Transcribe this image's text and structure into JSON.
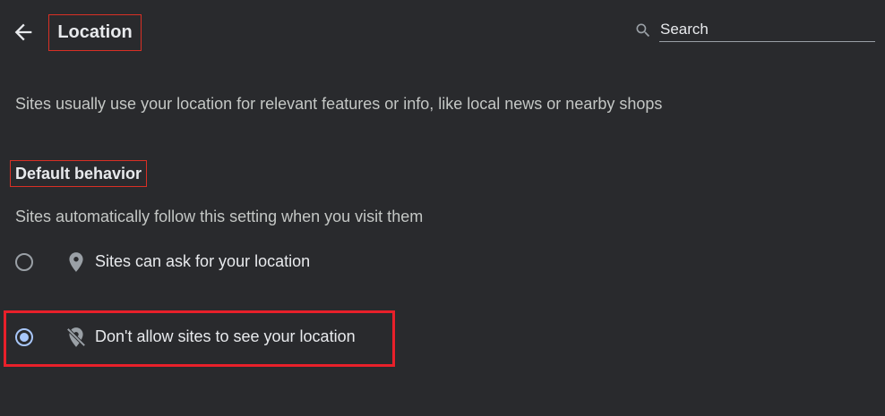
{
  "header": {
    "title": "Location",
    "back_icon": "arrow-left-icon",
    "search": {
      "placeholder": "Search",
      "icon": "search-icon"
    }
  },
  "description": "Sites usually use your location for relevant features or info, like local news or nearby shops",
  "default_behavior": {
    "heading": "Default behavior",
    "subtext": "Sites automatically follow this setting when you visit them",
    "options": [
      {
        "label": "Sites can ask for your location",
        "icon": "location-pin-icon",
        "selected": false
      },
      {
        "label": "Don't allow sites to see your location",
        "icon": "location-off-icon",
        "selected": true
      }
    ]
  },
  "colors": {
    "background": "#292a2d",
    "text": "#e8eaed",
    "secondary_text": "#c4c7c5",
    "accent": "#a8c7fa",
    "highlight": "#e8202a"
  }
}
